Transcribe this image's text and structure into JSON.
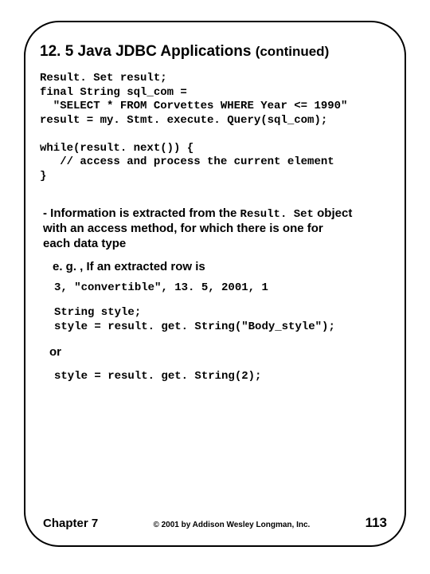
{
  "heading": {
    "main": "12. 5 Java JDBC Applications ",
    "cont": "(continued)"
  },
  "code_block_1": "Result. Set result;\nfinal String sql_com =\n  \"SELECT * FROM Corvettes WHERE Year <= 1990\"\nresult = my. Stmt. execute. Query(sql_com);\n\nwhile(result. next()) {\n   // access and process the current element\n}",
  "bullet": {
    "lead": " - Information is extracted from the ",
    "code_term": "Result. Set",
    "tail": " object\n    with an access method, for which there is one for\n    each data type"
  },
  "subtext_eg": "e. g. , If an extracted row is",
  "code_row": "3, \"convertible\", 13. 5, 2001, 1",
  "code_block_2": "String style;\nstyle = result. get. String(\"Body_style\");",
  "or_label": "or",
  "code_block_3": "style = result. get. String(2);",
  "footer": {
    "chapter": "Chapter 7",
    "copyright": "© 2001 by Addison Wesley Longman, Inc.",
    "page": "113"
  }
}
